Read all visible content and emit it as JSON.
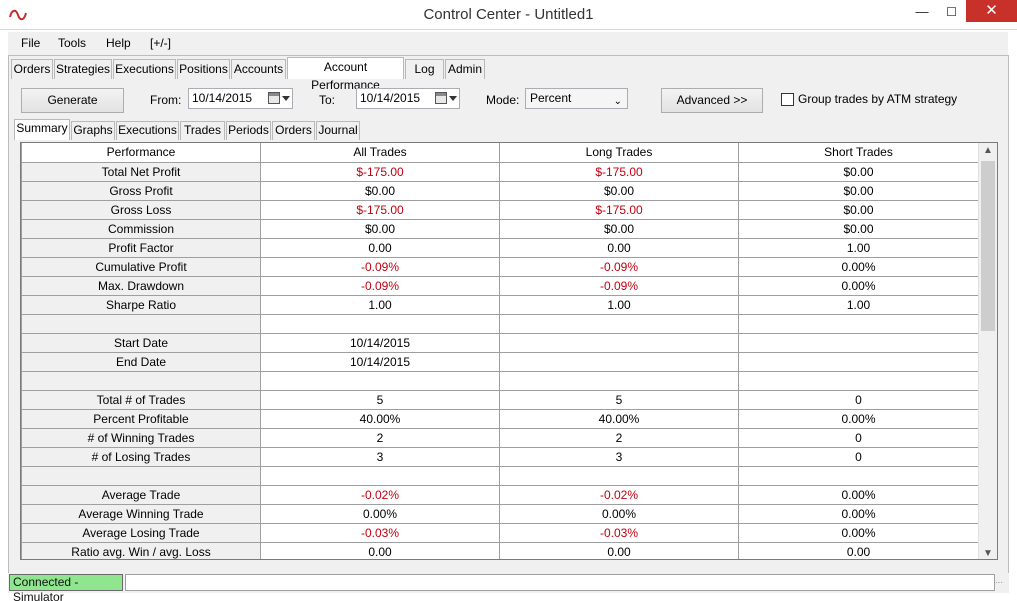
{
  "window": {
    "title": "Control Center - Untitled1",
    "min_glyph": "—",
    "max_glyph": "☐",
    "close_glyph": "✕",
    "logo_icon": "wave-logo-icon"
  },
  "menu": [
    "File",
    "Tools",
    "Help",
    "[+/-]"
  ],
  "tabs": [
    "Orders",
    "Strategies",
    "Executions",
    "Positions",
    "Accounts",
    "Account Performance",
    "Log",
    "Admin"
  ],
  "active_tab": "Account Performance",
  "toolbar": {
    "generate_label": "Generate",
    "from_label": "From:",
    "from_value": "10/14/2015",
    "to_label": "To:",
    "to_value": "10/14/2015",
    "mode_label": "Mode:",
    "mode_value": "Percent",
    "advanced_label": "Advanced >>",
    "group_checkbox_label": "Group trades by ATM strategy",
    "group_checked": false
  },
  "subtabs": [
    "Summary",
    "Graphs",
    "Executions",
    "Trades",
    "Periods",
    "Orders",
    "Journal"
  ],
  "active_subtab": "Summary",
  "grid": {
    "columns": [
      "Performance",
      "All Trades",
      "Long Trades",
      "Short Trades"
    ],
    "rows": [
      [
        "Total Net Profit",
        "$-175.00",
        "$-175.00",
        "$0.00"
      ],
      [
        "Gross Profit",
        "$0.00",
        "$0.00",
        "$0.00"
      ],
      [
        "Gross Loss",
        "$-175.00",
        "$-175.00",
        "$0.00"
      ],
      [
        "Commission",
        "$0.00",
        "$0.00",
        "$0.00"
      ],
      [
        "Profit Factor",
        "0.00",
        "0.00",
        "1.00"
      ],
      [
        "Cumulative Profit",
        "-0.09%",
        "-0.09%",
        "0.00%"
      ],
      [
        "Max. Drawdown",
        "-0.09%",
        "-0.09%",
        "0.00%"
      ],
      [
        "Sharpe Ratio",
        "1.00",
        "1.00",
        "1.00"
      ],
      [
        "",
        "",
        "",
        ""
      ],
      [
        "Start Date",
        "10/14/2015",
        "",
        ""
      ],
      [
        "End Date",
        "10/14/2015",
        "",
        ""
      ],
      [
        "",
        "",
        "",
        ""
      ],
      [
        "Total # of Trades",
        "5",
        "5",
        "0"
      ],
      [
        "Percent Profitable",
        "40.00%",
        "40.00%",
        "0.00%"
      ],
      [
        "# of Winning Trades",
        "2",
        "2",
        "0"
      ],
      [
        "# of Losing Trades",
        "3",
        "3",
        "0"
      ],
      [
        "",
        "",
        "",
        ""
      ],
      [
        "Average Trade",
        "-0.02%",
        "-0.02%",
        "0.00%"
      ],
      [
        "Average Winning Trade",
        "0.00%",
        "0.00%",
        "0.00%"
      ],
      [
        "Average Losing Trade",
        "-0.03%",
        "-0.03%",
        "0.00%"
      ],
      [
        "Ratio avg. Win / avg. Loss",
        "0.00",
        "0.00",
        "0.00"
      ]
    ],
    "negative_color": "#c0000f"
  },
  "status": {
    "connection": "Connected - Simulator",
    "connection_color": "#8fe68f"
  }
}
